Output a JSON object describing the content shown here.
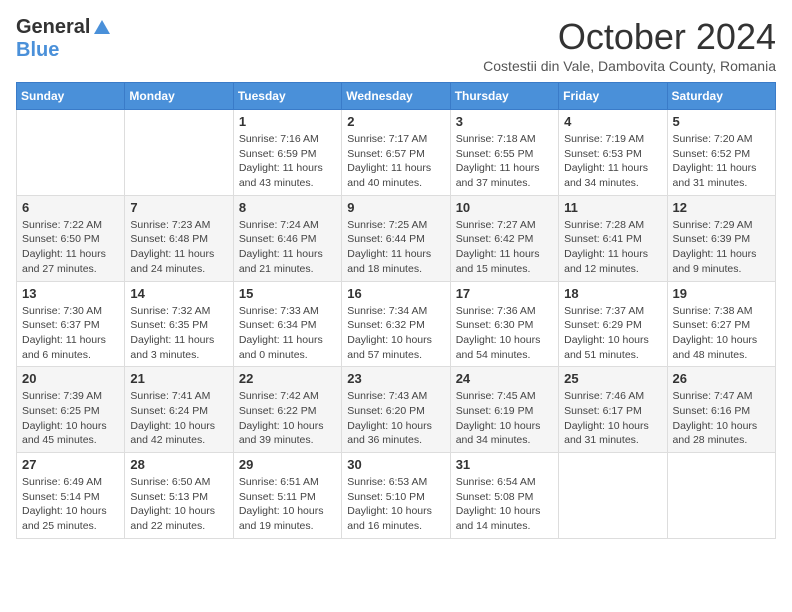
{
  "header": {
    "logo_general": "General",
    "logo_blue": "Blue",
    "month_title": "October 2024",
    "subtitle": "Costestii din Vale, Dambovita County, Romania"
  },
  "days_of_week": [
    "Sunday",
    "Monday",
    "Tuesday",
    "Wednesday",
    "Thursday",
    "Friday",
    "Saturday"
  ],
  "weeks": [
    [
      {
        "day": null
      },
      {
        "day": null
      },
      {
        "day": 1,
        "sunrise": "7:16 AM",
        "sunset": "6:59 PM",
        "daylight": "11 hours and 43 minutes."
      },
      {
        "day": 2,
        "sunrise": "7:17 AM",
        "sunset": "6:57 PM",
        "daylight": "11 hours and 40 minutes."
      },
      {
        "day": 3,
        "sunrise": "7:18 AM",
        "sunset": "6:55 PM",
        "daylight": "11 hours and 37 minutes."
      },
      {
        "day": 4,
        "sunrise": "7:19 AM",
        "sunset": "6:53 PM",
        "daylight": "11 hours and 34 minutes."
      },
      {
        "day": 5,
        "sunrise": "7:20 AM",
        "sunset": "6:52 PM",
        "daylight": "11 hours and 31 minutes."
      }
    ],
    [
      {
        "day": 6,
        "sunrise": "7:22 AM",
        "sunset": "6:50 PM",
        "daylight": "11 hours and 27 minutes."
      },
      {
        "day": 7,
        "sunrise": "7:23 AM",
        "sunset": "6:48 PM",
        "daylight": "11 hours and 24 minutes."
      },
      {
        "day": 8,
        "sunrise": "7:24 AM",
        "sunset": "6:46 PM",
        "daylight": "11 hours and 21 minutes."
      },
      {
        "day": 9,
        "sunrise": "7:25 AM",
        "sunset": "6:44 PM",
        "daylight": "11 hours and 18 minutes."
      },
      {
        "day": 10,
        "sunrise": "7:27 AM",
        "sunset": "6:42 PM",
        "daylight": "11 hours and 15 minutes."
      },
      {
        "day": 11,
        "sunrise": "7:28 AM",
        "sunset": "6:41 PM",
        "daylight": "11 hours and 12 minutes."
      },
      {
        "day": 12,
        "sunrise": "7:29 AM",
        "sunset": "6:39 PM",
        "daylight": "11 hours and 9 minutes."
      }
    ],
    [
      {
        "day": 13,
        "sunrise": "7:30 AM",
        "sunset": "6:37 PM",
        "daylight": "11 hours and 6 minutes."
      },
      {
        "day": 14,
        "sunrise": "7:32 AM",
        "sunset": "6:35 PM",
        "daylight": "11 hours and 3 minutes."
      },
      {
        "day": 15,
        "sunrise": "7:33 AM",
        "sunset": "6:34 PM",
        "daylight": "11 hours and 0 minutes."
      },
      {
        "day": 16,
        "sunrise": "7:34 AM",
        "sunset": "6:32 PM",
        "daylight": "10 hours and 57 minutes."
      },
      {
        "day": 17,
        "sunrise": "7:36 AM",
        "sunset": "6:30 PM",
        "daylight": "10 hours and 54 minutes."
      },
      {
        "day": 18,
        "sunrise": "7:37 AM",
        "sunset": "6:29 PM",
        "daylight": "10 hours and 51 minutes."
      },
      {
        "day": 19,
        "sunrise": "7:38 AM",
        "sunset": "6:27 PM",
        "daylight": "10 hours and 48 minutes."
      }
    ],
    [
      {
        "day": 20,
        "sunrise": "7:39 AM",
        "sunset": "6:25 PM",
        "daylight": "10 hours and 45 minutes."
      },
      {
        "day": 21,
        "sunrise": "7:41 AM",
        "sunset": "6:24 PM",
        "daylight": "10 hours and 42 minutes."
      },
      {
        "day": 22,
        "sunrise": "7:42 AM",
        "sunset": "6:22 PM",
        "daylight": "10 hours and 39 minutes."
      },
      {
        "day": 23,
        "sunrise": "7:43 AM",
        "sunset": "6:20 PM",
        "daylight": "10 hours and 36 minutes."
      },
      {
        "day": 24,
        "sunrise": "7:45 AM",
        "sunset": "6:19 PM",
        "daylight": "10 hours and 34 minutes."
      },
      {
        "day": 25,
        "sunrise": "7:46 AM",
        "sunset": "6:17 PM",
        "daylight": "10 hours and 31 minutes."
      },
      {
        "day": 26,
        "sunrise": "7:47 AM",
        "sunset": "6:16 PM",
        "daylight": "10 hours and 28 minutes."
      }
    ],
    [
      {
        "day": 27,
        "sunrise": "6:49 AM",
        "sunset": "5:14 PM",
        "daylight": "10 hours and 25 minutes."
      },
      {
        "day": 28,
        "sunrise": "6:50 AM",
        "sunset": "5:13 PM",
        "daylight": "10 hours and 22 minutes."
      },
      {
        "day": 29,
        "sunrise": "6:51 AM",
        "sunset": "5:11 PM",
        "daylight": "10 hours and 19 minutes."
      },
      {
        "day": 30,
        "sunrise": "6:53 AM",
        "sunset": "5:10 PM",
        "daylight": "10 hours and 16 minutes."
      },
      {
        "day": 31,
        "sunrise": "6:54 AM",
        "sunset": "5:08 PM",
        "daylight": "10 hours and 14 minutes."
      },
      {
        "day": null
      },
      {
        "day": null
      }
    ]
  ]
}
